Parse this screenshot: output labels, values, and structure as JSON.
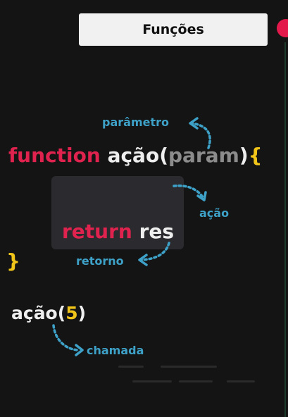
{
  "title": "Funções",
  "code": {
    "function_kw": "function",
    "function_name": "ação",
    "open_paren": "(",
    "param": "param",
    "close_paren": ")",
    "open_brace": "{",
    "return_kw": "return",
    "return_value": "res",
    "close_brace": "}",
    "call_name": "ação",
    "call_open": "(",
    "call_arg": "5",
    "call_close": ")"
  },
  "labels": {
    "parameter": "parâmetro",
    "action": "ação",
    "return": "retorno",
    "call": "chamada"
  },
  "colors": {
    "keyword": "#e0234e",
    "identifier": "#eeeeee",
    "param": "#8c8c8c",
    "brace": "#f0c419",
    "annotation": "#3ea1c8",
    "record_dot": "#e3194b"
  }
}
